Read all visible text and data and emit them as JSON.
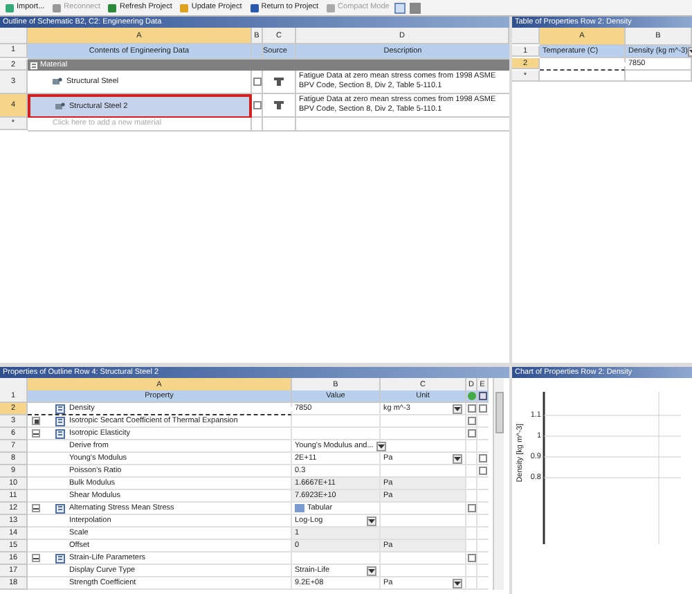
{
  "toolbar": [
    {
      "label": "Import...",
      "disabled": false
    },
    {
      "label": "Reconnect",
      "disabled": true
    },
    {
      "label": "Refresh Project",
      "disabled": false
    },
    {
      "label": "Update Project",
      "disabled": false
    },
    {
      "label": "Return to Project",
      "disabled": false
    },
    {
      "label": "Compact Mode",
      "disabled": true
    }
  ],
  "outline": {
    "title": "Outline of Schematic B2, C2: Engineering Data",
    "columns": [
      "A",
      "B",
      "C",
      "D"
    ],
    "header": {
      "number": "1",
      "contents": "Contents of Engineering Data",
      "source": "Source",
      "description": "Description"
    },
    "group": {
      "number": "2",
      "label": "Material",
      "expanded": true
    },
    "rows": [
      {
        "number": "3",
        "name": "Structural Steel",
        "checked": false,
        "selected": false,
        "description": "Fatigue Data at zero mean stress comes from 1998 ASME BPV Code, Section 8, Div 2, Table 5-110.1"
      },
      {
        "number": "4",
        "name": "Structural Steel 2",
        "checked": false,
        "selected": true,
        "description": "Fatigue Data at zero mean stress comes from 1998 ASME BPV Code, Section 8, Div 2, Table 5-110.1"
      }
    ],
    "new_row": {
      "number": "*",
      "placeholder": "Click here to add a new material"
    }
  },
  "table": {
    "title": "Table of Properties Row 2: Density",
    "columns": [
      "A",
      "B"
    ],
    "rows": [
      {
        "number": "1",
        "cells": [
          "Temperature (C)",
          "Density (kg m^-3)"
        ],
        "selected": false
      },
      {
        "number": "2",
        "cells": [
          "",
          "7850"
        ],
        "selected": true
      },
      {
        "number": "*",
        "cells": [
          "",
          ""
        ],
        "selected": false
      }
    ]
  },
  "properties": {
    "title": "Properties of Outline Row 4: Structural Steel 2",
    "columns": [
      "A",
      "B",
      "C",
      "D",
      "E"
    ],
    "header": {
      "number": "1",
      "property": "Property",
      "value": "Value",
      "unit": "Unit"
    },
    "rows": [
      {
        "number": "2",
        "kind": "group",
        "property": "Density",
        "value": "7850",
        "unit": "kg m^-3",
        "unit_dropdown": true,
        "d": false,
        "e": false,
        "selected": true
      },
      {
        "number": "3",
        "kind": "group",
        "property": "Isotropic Secant Coefficient of Thermal Expansion",
        "expanded": false,
        "d": false,
        "selected": false
      },
      {
        "number": "6",
        "kind": "group",
        "property": "Isotropic Elasticity",
        "expanded": true,
        "d": false,
        "selected": false
      },
      {
        "number": "7",
        "kind": "item",
        "property": "Derive from",
        "value": "Young's Modulus and...",
        "value_dropdown": true,
        "selected": false
      },
      {
        "number": "8",
        "kind": "item",
        "property": "Young's Modulus",
        "value": "2E+11",
        "unit": "Pa",
        "unit_dropdown": true,
        "e": false,
        "selected": false
      },
      {
        "number": "9",
        "kind": "item",
        "property": "Poisson's Ratio",
        "value": "0.3",
        "e": false,
        "selected": false
      },
      {
        "number": "10",
        "kind": "item",
        "property": "Bulk Modulus",
        "value": "1.6667E+11",
        "unit": "Pa",
        "readonly": true,
        "selected": false
      },
      {
        "number": "11",
        "kind": "item",
        "property": "Shear Modulus",
        "value": "7.6923E+10",
        "unit": "Pa",
        "readonly": true,
        "selected": false
      },
      {
        "number": "12",
        "kind": "group",
        "property": "Alternating Stress Mean Stress",
        "expanded": true,
        "value": "Tabular",
        "d": false,
        "selected": false
      },
      {
        "number": "13",
        "kind": "item",
        "property": "Interpolation",
        "value": "Log-Log",
        "value_dropdown": true,
        "selected": false
      },
      {
        "number": "14",
        "kind": "item",
        "property": "Scale",
        "value": "1",
        "readonly": true,
        "selected": false
      },
      {
        "number": "15",
        "kind": "item",
        "property": "Offset",
        "value": "0",
        "unit": "Pa",
        "readonly": true,
        "selected": false
      },
      {
        "number": "16",
        "kind": "group",
        "property": "Strain-Life Parameters",
        "expanded": true,
        "d": false,
        "selected": false
      },
      {
        "number": "17",
        "kind": "item",
        "property": "Display Curve Type",
        "value": "Strain-Life",
        "value_dropdown": true,
        "selected": false
      },
      {
        "number": "18",
        "kind": "item",
        "property": "Strength Coefficient",
        "value": "9.2E+08",
        "unit": "Pa",
        "unit_dropdown": true,
        "selected": false
      }
    ]
  },
  "chart": {
    "title": "Chart of Properties Row 2: Density",
    "ylabel": "Density [kg m^-3]",
    "yticks": [
      "1.1",
      "1",
      "0.9",
      "0.8"
    ]
  }
}
